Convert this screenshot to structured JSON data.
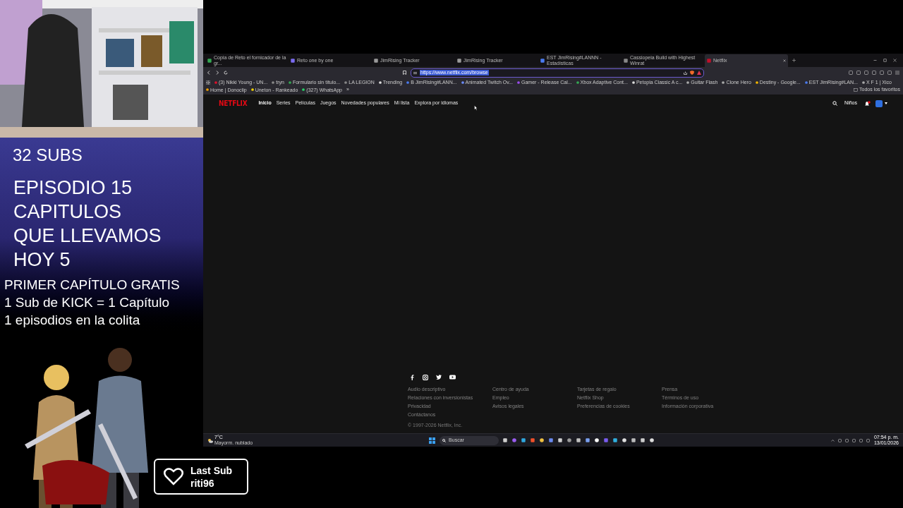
{
  "overlay": {
    "subs": "32 SUBS",
    "episode_lines": [
      "EPISODIO 15",
      "CAPITULOS",
      "QUE LLEVAMOS",
      "HOY 5"
    ],
    "info_lines": [
      "PRIMER CAPÍTULO GRATIS",
      "1 Sub de KICK = 1 Capítulo",
      "1 episodios en la colita"
    ],
    "last_sub": {
      "label": "Last Sub",
      "name": "riti96"
    }
  },
  "browser": {
    "tabs": [
      {
        "label": "Copia de Reto el fornicador de la gr...",
        "selected": false,
        "color": "#34a853"
      },
      {
        "label": "Reto one by one",
        "selected": false,
        "color": "#7b6cf0"
      },
      {
        "label": "JimRising Tracker",
        "selected": false,
        "color": "#9a9a9a"
      },
      {
        "label": "JimRising Tracker",
        "selected": false,
        "color": "#9a9a9a"
      },
      {
        "label": "EST JimRising#LANNN - Estadísticas",
        "selected": false,
        "color": "#4a7bf0"
      },
      {
        "label": "Cassiopeia Build with Highest Winrat",
        "selected": false,
        "color": "#888888"
      },
      {
        "label": "Netflix",
        "selected": true,
        "color": "#c0102a"
      }
    ],
    "url": "https://www.netflix.com/browse",
    "bookmarks": [
      {
        "label": "(3) Nikki Young - UN...",
        "color": "#e0102a"
      },
      {
        "label": "tryn",
        "color": "#888888"
      },
      {
        "label": "Formulario sin título...",
        "color": "#34a853"
      },
      {
        "label": "LA LEGION",
        "color": "#888888"
      },
      {
        "label": "Trending",
        "color": "#dddddd"
      },
      {
        "label": "B JimRising#LANN...",
        "color": "#4a7bf0"
      },
      {
        "label": "Animated Twitch Ov...",
        "color": "#6c8cff"
      },
      {
        "label": "Gamer - Release Cal...",
        "color": "#9b4cf0"
      },
      {
        "label": "Xbox Adaptive Cont...",
        "color": "#34a853"
      },
      {
        "label": "Petopia Classic A c...",
        "color": "#dddddd"
      },
      {
        "label": "Guitar Flash",
        "color": "#aaaaaa"
      },
      {
        "label": "Clone Hero",
        "color": "#aaaaaa"
      },
      {
        "label": "Destiny - Google...",
        "color": "#f0b400"
      },
      {
        "label": "EST JimRising#LAN...",
        "color": "#4a7bf0"
      },
      {
        "label": "X F 1 | Xico",
        "color": "#aaaaaa"
      },
      {
        "label": "Home | Donoclip",
        "color": "#f0a000"
      },
      {
        "label": "Uneton - Rankeado",
        "color": "#f0d000"
      },
      {
        "label": "(327) WhatsApp",
        "color": "#25d366"
      }
    ],
    "more_bookmarks": "»",
    "all_bookmarks": "Todos los favoritos"
  },
  "netflix": {
    "logo": "NETFLIX",
    "nav": [
      {
        "label": "Inicio",
        "selected": true
      },
      {
        "label": "Series",
        "selected": false
      },
      {
        "label": "Películas",
        "selected": false
      },
      {
        "label": "Juegos",
        "selected": false
      },
      {
        "label": "Novedades populares",
        "selected": false
      },
      {
        "label": "Mi lista",
        "selected": false
      },
      {
        "label": "Explora por idiomas",
        "selected": false
      }
    ],
    "kids": "Niños",
    "footer_columns": [
      [
        "Audio descriptivo",
        "Relaciones con inversionistas",
        "Privacidad",
        "Contáctanos"
      ],
      [
        "Centro de ayuda",
        "Empleo",
        "Avisos legales"
      ],
      [
        "Tarjetas de regalo",
        "Netflix Shop",
        "Preferencias de cookies"
      ],
      [
        "Prensa",
        "Términos de uso",
        "Información corporativa"
      ]
    ],
    "copyright": "© 1997-2026 Netflix, Inc."
  },
  "taskbar": {
    "temperature": "7°C",
    "weather": "Mayorm. nublado",
    "search_placeholder": "Buscar",
    "time": "07:54 p. m.",
    "date": "13/01/2026"
  }
}
